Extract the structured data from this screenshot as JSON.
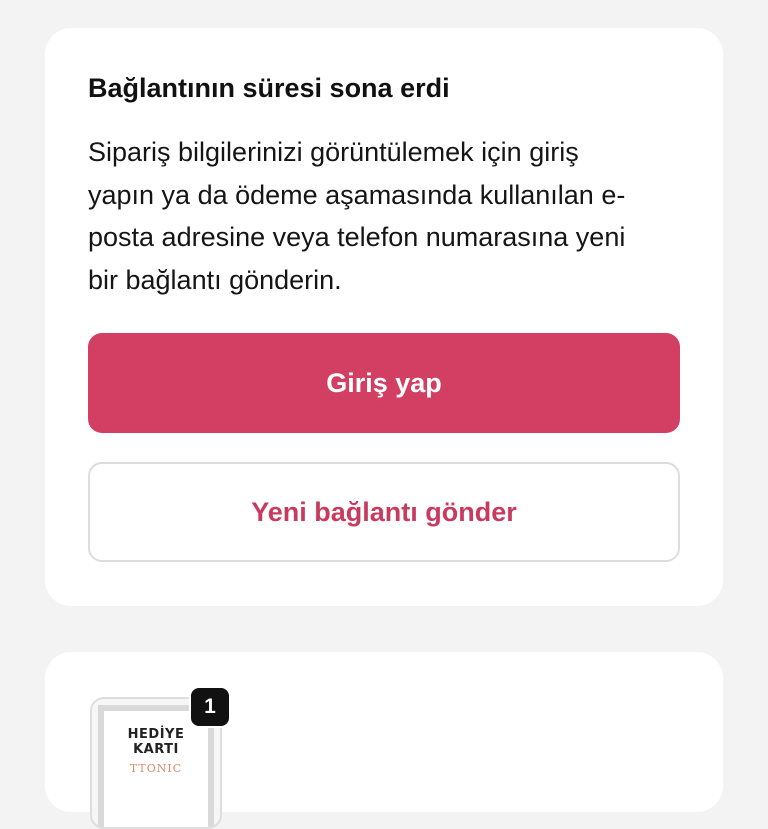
{
  "expired_card": {
    "title": "Bağlantının süresi sona erdi",
    "message_lines": [
      "Sipariş bilgilerinizi görüntülemek için giriş",
      "yapın ya da ödeme aşamasında kullanılan e-",
      "posta adresine veya telefon numarasına yeni",
      "bir bağlantı gönderin."
    ],
    "login_button": "Giriş yap",
    "resend_button": "Yeni bağlantı gönder"
  },
  "order_card": {
    "item": {
      "quantity": "1",
      "thumbnail_text_line1": "HEDİYE",
      "thumbnail_text_line2": "KARTI",
      "thumbnail_brand": "TTONIC"
    }
  },
  "colors": {
    "background": "#f3f3f3",
    "primary": "#d23f63",
    "primary_text": "#c93a5f"
  }
}
